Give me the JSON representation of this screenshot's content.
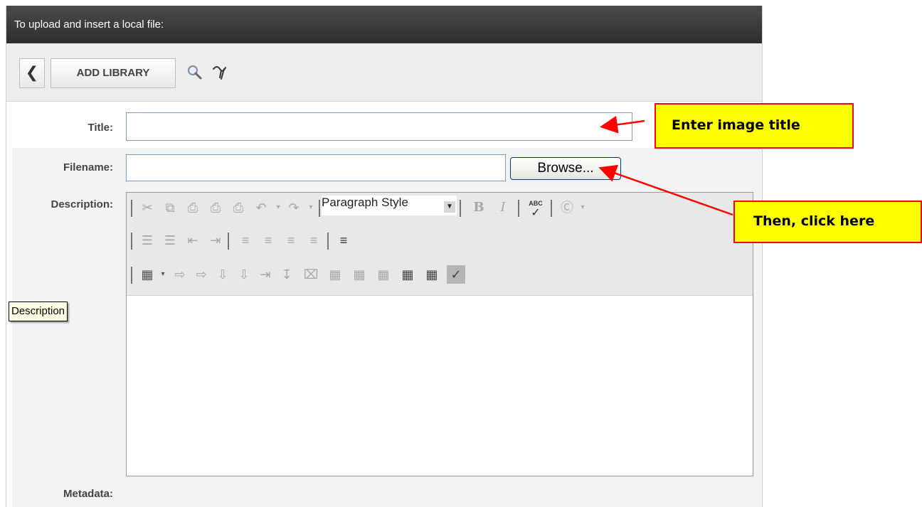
{
  "header": {
    "title": "To upload and insert a local file:"
  },
  "toolbar": {
    "back_icon": "chevron-left-icon",
    "add_library_label": "ADD LIBRARY",
    "search_icon": "magnifier-icon",
    "reset_icon": "squiggle-icon"
  },
  "form": {
    "title_label": "Title:",
    "title_value": "",
    "filename_label": "Filename:",
    "filename_value": "",
    "browse_label": "Browse...",
    "description_label": "Description:",
    "metadata_label": "Metadata:"
  },
  "editor": {
    "paragraph_style": "Paragraph Style",
    "bold": "B",
    "italic": "I",
    "spellcheck": "ABC",
    "tooltip": "Description"
  },
  "callouts": {
    "title_hint": "Enter image title",
    "browse_hint": "Then, click here"
  },
  "colors": {
    "callout_bg": "#ffff00",
    "callout_border": "#ff0000",
    "header_bg": "#3a3a3a"
  }
}
